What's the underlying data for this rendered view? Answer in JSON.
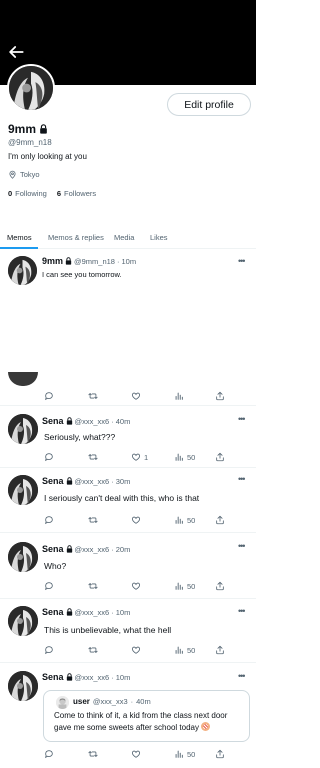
{
  "profile": {
    "name": "9mm",
    "handle": "@9mm_n18",
    "bio": "I'm only looking at you",
    "location": "Tokyo",
    "following_count": "0",
    "following_label": "Following",
    "followers_count": "6",
    "followers_label": "Followers",
    "edit_label": "Edit profile"
  },
  "tabs": [
    "Memos",
    "Memos & replies",
    "Media",
    "Likes"
  ],
  "posts": [
    {
      "name": "9mm",
      "handle": "@9mm_n18",
      "time": "10m",
      "text": "I can see you tomorrow."
    },
    {
      "name": "Sena",
      "handle": "@xxx_xx6",
      "time": "40m",
      "text": "Seriously, what???",
      "likes": "1",
      "views": "50"
    },
    {
      "name": "Sena",
      "handle": "@xxx_xx6",
      "time": "30m",
      "text": "I seriously can't deal with this, who is that",
      "views": "50"
    },
    {
      "name": "Sena",
      "handle": "@xxx_xx6",
      "time": "20m",
      "text": "Who?",
      "views": "50"
    },
    {
      "name": "Sena",
      "handle": "@xxx_xx6",
      "time": "10m",
      "text": "This is unbelievable, what the hell",
      "views": "50"
    },
    {
      "name": "Sena",
      "handle": "@xxx_xx6",
      "time": "10m",
      "views": "50",
      "quote": {
        "name": "user",
        "handle": "@xxx_xx3",
        "time": "40m",
        "text": "Come to think of it, a kid from the class next door gave me some sweets after school today"
      }
    }
  ],
  "separator": "·",
  "more_glyph": "•••",
  "colors": {
    "accent": "#1d9bf0",
    "muted": "#536471",
    "text": "#0f1419",
    "banner": "#000000"
  },
  "icons": [
    "back-arrow-icon",
    "lock-icon",
    "location-pin-icon",
    "reply-icon",
    "repost-icon",
    "like-icon",
    "views-icon",
    "share-icon",
    "more-icon"
  ]
}
